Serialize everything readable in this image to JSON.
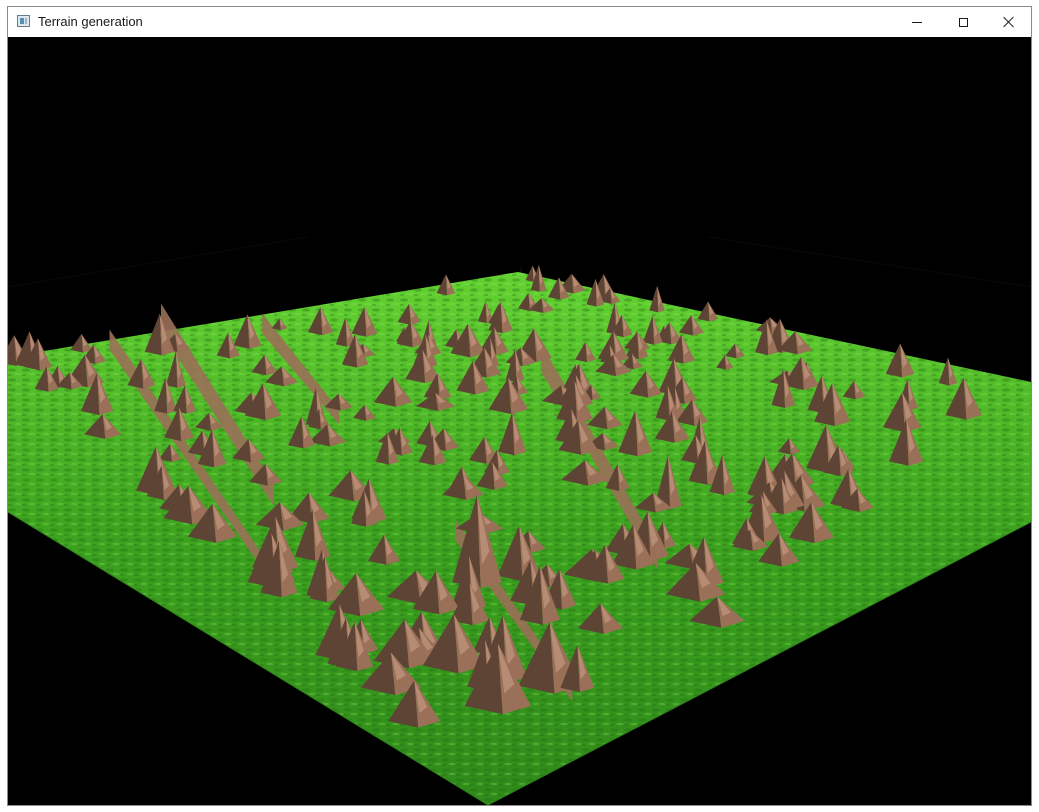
{
  "window": {
    "title": "Terrain generation",
    "icon": "app-window-icon",
    "controls": {
      "minimize_icon": "minimize-icon",
      "maximize_icon": "maximize-icon",
      "close_icon": "close-icon"
    }
  },
  "scene": {
    "background_color": "#000000",
    "grass_color": "#3fae22",
    "grass_highlight": "#6edc3a",
    "rock_color": "#9a7058",
    "rock_shadow": "#5e4434",
    "rock_highlight": "#c29a80"
  }
}
